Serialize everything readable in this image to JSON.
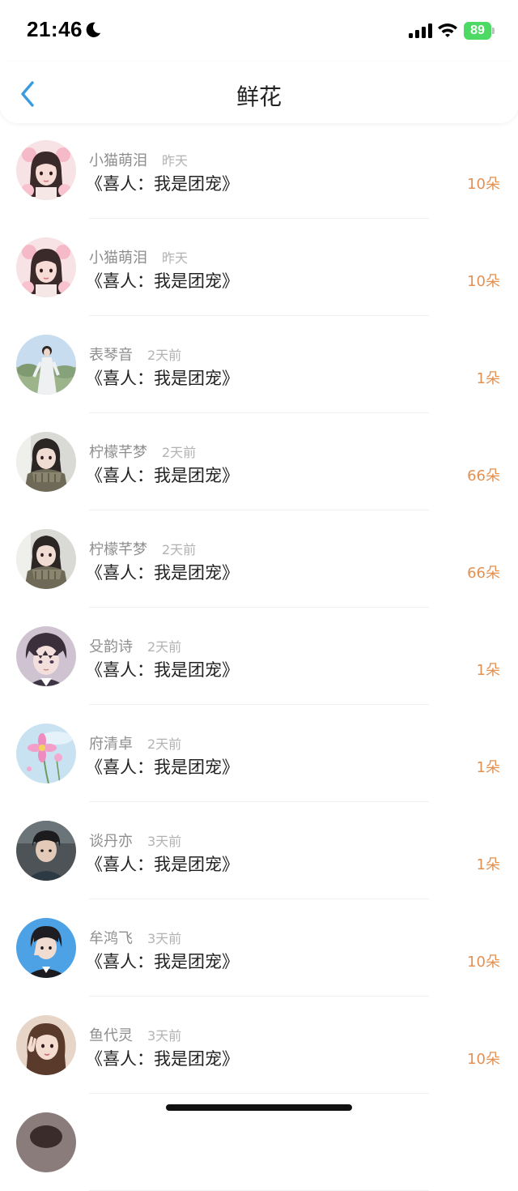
{
  "status_bar": {
    "time": "21:46",
    "battery": "89"
  },
  "nav": {
    "title": "鲜花"
  },
  "list": [
    {
      "name": "小猫萌泪",
      "time": "昨天",
      "title": "《喜人：我是团宠》",
      "count": "10朵",
      "avatar": "girl-pink-bow"
    },
    {
      "name": "小猫萌泪",
      "time": "昨天",
      "title": "《喜人：我是团宠》",
      "count": "10朵",
      "avatar": "girl-pink-bow"
    },
    {
      "name": "表琴音",
      "time": "2天前",
      "title": "《喜人：我是团宠》",
      "count": "1朵",
      "avatar": "girl-outdoor-white-dress"
    },
    {
      "name": "柠檬芊梦",
      "time": "2天前",
      "title": "《喜人：我是团宠》",
      "count": "66朵",
      "avatar": "girl-scarf"
    },
    {
      "name": "柠檬芊梦",
      "time": "2天前",
      "title": "《喜人：我是团宠》",
      "count": "66朵",
      "avatar": "girl-scarf"
    },
    {
      "name": "殳韵诗",
      "time": "2天前",
      "title": "《喜人：我是团宠》",
      "count": "1朵",
      "avatar": "anime-boy"
    },
    {
      "name": "府清卓",
      "time": "2天前",
      "title": "《喜人：我是团宠》",
      "count": "1朵",
      "avatar": "pink-flower"
    },
    {
      "name": "谈丹亦",
      "time": "3天前",
      "title": "《喜人：我是团宠》",
      "count": "1朵",
      "avatar": "boy-dark"
    },
    {
      "name": "牟鸿飞",
      "time": "3天前",
      "title": "《喜人：我是团宠》",
      "count": "10朵",
      "avatar": "boy-blue-bg"
    },
    {
      "name": "鱼代灵",
      "time": "3天前",
      "title": "《喜人：我是团宠》",
      "count": "10朵",
      "avatar": "girl-peace-sign"
    },
    {
      "name": "",
      "time": "",
      "title": "",
      "count": "",
      "avatar": "partial"
    }
  ],
  "colors": {
    "accent": "#3a9be0",
    "count": "#e39152",
    "battery": "#4cd964"
  }
}
